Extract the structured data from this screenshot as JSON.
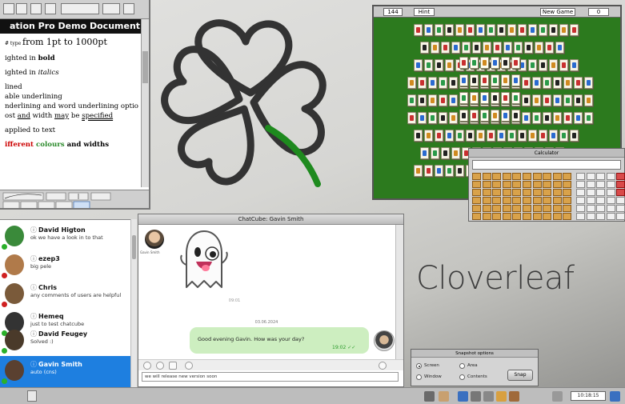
{
  "document": {
    "title": "ation Pro Demo Document - St",
    "lines": {
      "l1": {
        "a": "# type ",
        "b": "from 1pt to 1000pt"
      },
      "l2": {
        "a": "ighted in ",
        "b": "bold"
      },
      "l3": {
        "a": "ighted in ",
        "b": "italics"
      },
      "l4": "lined",
      "l5": "able underlining",
      "l6": "nderlining and word underlining optio",
      "l7": {
        "a": "ost ",
        "b": "and",
        "c": " width ",
        "d": "may",
        "e": " be ",
        "f": "specified"
      },
      "l8": "applied to text",
      "l9": {
        "a": "ifferent",
        "b": " colours",
        "c": " and widths"
      }
    }
  },
  "mahjong": {
    "tiles_left": "144",
    "hint_label": "Hint",
    "new_game_label": "New Game",
    "score": "0"
  },
  "calculator": {
    "title": "Calculator"
  },
  "brand": "Cloverleaf",
  "contacts": [
    {
      "name": "David Higton",
      "message": "ok we have a look in to that",
      "status_color": "#2ab02a",
      "avatar_color": "#3a8a3a"
    },
    {
      "name": "ezep3",
      "message": "big pele",
      "status_color": "#d02020",
      "avatar_color": "#b07a4a"
    },
    {
      "name": "Chris",
      "message": "any comments of users are helpful",
      "status_color": "#d02020",
      "avatar_color": "#7a5a3a"
    },
    {
      "name": "Hemeq",
      "message": "just to test chatcube",
      "status_color": "#2ab02a",
      "avatar_color": "#333333"
    },
    {
      "name": "David Feugey",
      "message": "Solved :)",
      "status_color": "#2ab02a",
      "avatar_color": "#4a3a2a"
    },
    {
      "name": "Gavin Smith",
      "message": "auto (cns)",
      "status_color": "#2ab02a",
      "avatar_color": "#5a4030"
    }
  ],
  "chat": {
    "title": "ChatCube: Gavin Smith",
    "sender_name": "Gavin Smith",
    "sticker_time": "09:01",
    "date": "03.06.2024",
    "message": "Good evening Gavin. How was your day?",
    "message_ticks": "19:02 ✓✓",
    "input_text": "we will release new version soon"
  },
  "snapshot": {
    "title": "Snapshot options",
    "screen_label": "Screen",
    "area_label": "Area",
    "window_label": "Window",
    "contents_label": "Contents",
    "button_label": "Snap"
  },
  "iconbar": {
    "clock": "10:18:15"
  },
  "colors": {
    "clover_stroke": "#333333",
    "clover_stem": "#1e8a1e",
    "mahjong_felt": "#2c7a1e",
    "calc_key": "#d9a24a",
    "selected_contact": "#1e7fe0",
    "chat_bubble": "#cdeec0"
  },
  "icons": [
    "clover-icon",
    "ghost-sticker-icon",
    "info-icon",
    "attach-icon",
    "emoji-icon",
    "send-icon"
  ]
}
